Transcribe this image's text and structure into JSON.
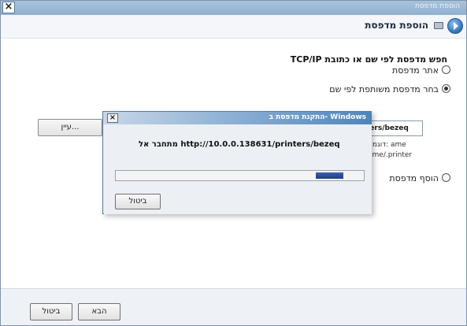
{
  "window": {
    "title": "הוספת מדפסת"
  },
  "header": {
    "title": "הוספת מדפסת"
  },
  "main": {
    "heading": "חפש מדפסת לפי שם או כתובת TCP/IP",
    "options": [
      {
        "label": "אתר מדפסת",
        "checked": false
      },
      {
        "label": "בחר מדפסת משותפת לפי שם",
        "checked": true
      },
      {
        "label": "הוסף מדפסת",
        "checked": false
      }
    ],
    "url_value": "ters/bezeq",
    "example_line1": "דוגמה: ame",
    "example_line2": "ame/.printer",
    "select_button": "עיין..."
  },
  "dialog": {
    "title": "התקנת מדפסת ב- Windows",
    "message": "מתחבר אל http://10.0.0.138631/printers/bezeq",
    "progress": 0.11,
    "cancel": "ביטול"
  },
  "footer": {
    "next": "הבא",
    "cancel": "ביטול"
  },
  "colors": {
    "accent": "#2c6fb7",
    "progress": "#1d3f86"
  },
  "icons": {
    "back": "back-arrow-icon",
    "printer": "printer-icon",
    "close": "close-icon"
  }
}
